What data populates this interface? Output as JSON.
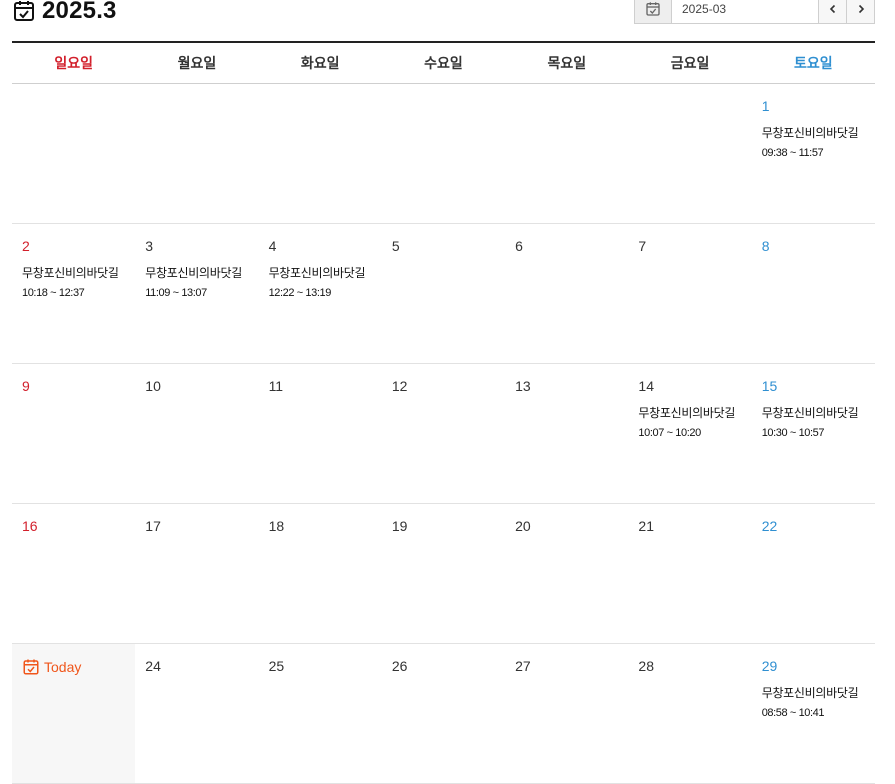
{
  "header": {
    "title": "2025.3",
    "month_value": "2025-03"
  },
  "weekdays": [
    "일요일",
    "월요일",
    "화요일",
    "수요일",
    "목요일",
    "금요일",
    "토요일"
  ],
  "today_label": "Today",
  "event_title": "무창포신비의바닷길",
  "days": [
    {
      "d": "1",
      "time": "09:38 ~ 11:57"
    },
    {
      "d": "2",
      "time": "10:18 ~ 12:37"
    },
    {
      "d": "3",
      "time": "11:09 ~ 13:07"
    },
    {
      "d": "4",
      "time": "12:22 ~ 13:19"
    },
    {
      "d": "5"
    },
    {
      "d": "6"
    },
    {
      "d": "7"
    },
    {
      "d": "8"
    },
    {
      "d": "9"
    },
    {
      "d": "10"
    },
    {
      "d": "11"
    },
    {
      "d": "12"
    },
    {
      "d": "13"
    },
    {
      "d": "14",
      "time": "10:07 ~ 10:20"
    },
    {
      "d": "15",
      "time": "10:30 ~ 10:57"
    },
    {
      "d": "16"
    },
    {
      "d": "17"
    },
    {
      "d": "18"
    },
    {
      "d": "19"
    },
    {
      "d": "20"
    },
    {
      "d": "21"
    },
    {
      "d": "22"
    },
    {
      "d": "24"
    },
    {
      "d": "25"
    },
    {
      "d": "26"
    },
    {
      "d": "27"
    },
    {
      "d": "28"
    },
    {
      "d": "29",
      "time": "08:58 ~ 10:41"
    }
  ],
  "colors": {
    "sunday": "#d21f2b",
    "saturday": "#2f8fd1",
    "today": "#f0561b"
  }
}
